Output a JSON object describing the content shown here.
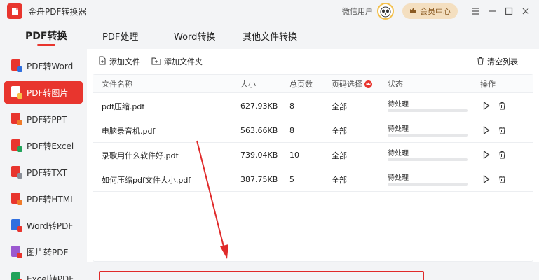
{
  "titlebar": {
    "app_name": "金舟PDF转换器",
    "username": "微信用户",
    "vip_label": "会员中心"
  },
  "topnav": {
    "tabs": [
      {
        "label": "PDF转换",
        "active": true
      },
      {
        "label": "PDF处理",
        "active": false
      },
      {
        "label": "Word转换",
        "active": false
      },
      {
        "label": "其他文件转换",
        "active": false
      }
    ]
  },
  "sidebar": {
    "items": [
      {
        "label": "PDF转Word",
        "active": false,
        "doc_color": "#e8352e",
        "badge_color": "#2f6fdf"
      },
      {
        "label": "PDF转图片",
        "active": true,
        "doc_color": "#ffffff",
        "badge_color": "#f7c04a"
      },
      {
        "label": "PDF转PPT",
        "active": false,
        "doc_color": "#e8352e",
        "badge_color": "#ef7b2a"
      },
      {
        "label": "PDF转Excel",
        "active": false,
        "doc_color": "#e8352e",
        "badge_color": "#22a35a"
      },
      {
        "label": "PDF转TXT",
        "active": false,
        "doc_color": "#e8352e",
        "badge_color": "#8a8f99"
      },
      {
        "label": "PDF转HTML",
        "active": false,
        "doc_color": "#e8352e",
        "badge_color": "#ef7b2a"
      },
      {
        "label": "Word转PDF",
        "active": false,
        "doc_color": "#2f6fdf",
        "badge_color": "#e8352e"
      },
      {
        "label": "图片转PDF",
        "active": false,
        "doc_color": "#9b59d0",
        "badge_color": "#e8352e"
      },
      {
        "label": "Excel转PDF",
        "active": false,
        "doc_color": "#22a35a",
        "badge_color": "#e8352e"
      }
    ]
  },
  "toolbar": {
    "add_file": "添加文件",
    "add_folder": "添加文件夹",
    "clear_list": "清空列表"
  },
  "table": {
    "headers": {
      "name": "文件名称",
      "size": "大小",
      "pages": "总页数",
      "page_select": "页码选择",
      "status": "状态",
      "actions": "操作"
    },
    "rows": [
      {
        "name": "pdf压缩.pdf",
        "size": "627.93KB",
        "pages": "8",
        "page_select": "全部",
        "status": "待处理",
        "progress": 0
      },
      {
        "name": "电脑录音机.pdf",
        "size": "563.66KB",
        "pages": "8",
        "page_select": "全部",
        "status": "待处理",
        "progress": 0
      },
      {
        "name": "录歌用什么软件好.pdf",
        "size": "739.04KB",
        "pages": "10",
        "page_select": "全部",
        "status": "待处理",
        "progress": 0
      },
      {
        "name": "如何压缩pdf文件大小.pdf",
        "size": "387.75KB",
        "pages": "5",
        "page_select": "全部",
        "status": "待处理",
        "progress": 0
      }
    ]
  },
  "colors": {
    "accent": "#e8352e",
    "annotation": "#e02a2a"
  }
}
